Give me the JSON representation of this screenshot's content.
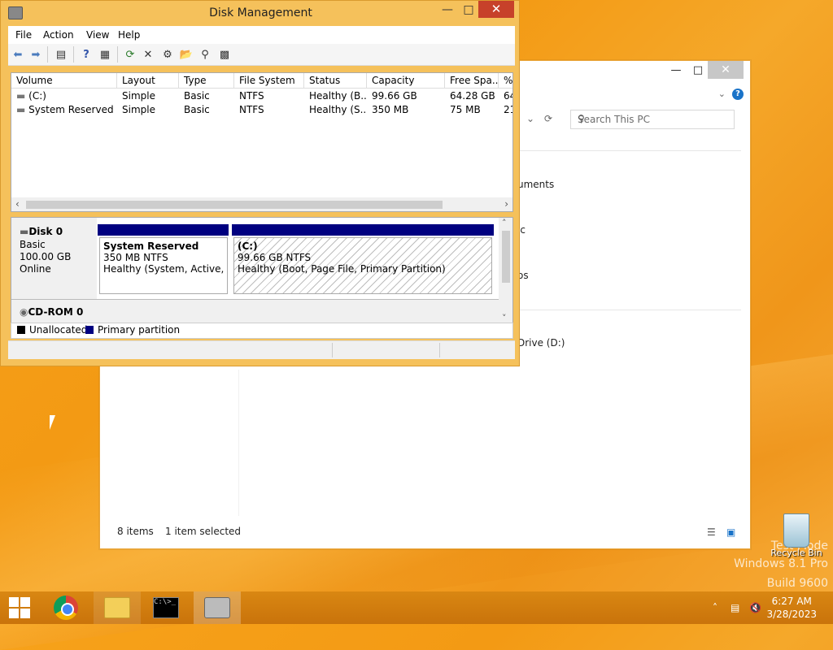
{
  "explorer": {
    "search_placeholder": "Search This PC",
    "partial_items": [
      "uments",
      "ic",
      "os",
      "Drive (D:)"
    ],
    "status_count": "8 items",
    "status_selected": "1 item selected",
    "minimize": "—",
    "maximize": "□",
    "close": "✕"
  },
  "dm": {
    "title": "Disk Management",
    "minimize": "—",
    "maximize": "□",
    "close": "✕",
    "menu": [
      "File",
      "Action",
      "View",
      "Help"
    ],
    "toolbar_icons": [
      "back-icon",
      "forward-icon",
      "console-icon",
      "help-icon",
      "properties-icon",
      "refresh-icon",
      "delete-icon",
      "settings-icon",
      "open-icon",
      "search-icon",
      "export-icon"
    ],
    "columns": [
      "Volume",
      "Layout",
      "Type",
      "File System",
      "Status",
      "Capacity",
      "Free Spa...",
      "%"
    ],
    "rows": [
      [
        "(C:)",
        "Simple",
        "Basic",
        "NTFS",
        "Healthy (B...",
        "99.66 GB",
        "64.28 GB",
        "64"
      ],
      [
        "System Reserved",
        "Simple",
        "Basic",
        "NTFS",
        "Healthy (S...",
        "350 MB",
        "75 MB",
        "21"
      ]
    ],
    "disks": [
      {
        "name": "Disk 0",
        "type": "Basic",
        "size": "100.00 GB",
        "state": "Online",
        "partitions": [
          {
            "name": "System Reserved",
            "size": "350 MB NTFS",
            "status": "Healthy (System, Active, Primary Partition)"
          },
          {
            "name": "(C:)",
            "size": "99.66 GB NTFS",
            "status": "Healthy (Boot, Page File, Primary Partition)"
          }
        ]
      },
      {
        "name": "CD-ROM 0"
      }
    ],
    "legend": [
      {
        "label": "Unallocated",
        "color": "#000000"
      },
      {
        "label": "Primary partition",
        "color": "#000080"
      }
    ]
  },
  "desktop": {
    "recycle_bin": "Recycle Bin",
    "watermark": [
      "Test Mode",
      "Windows 8.1 Pro",
      "Build 9600"
    ]
  },
  "taskbar": {
    "time": "6:27 AM",
    "date": "3/28/2023",
    "cmd_text": "C:\\>_"
  }
}
